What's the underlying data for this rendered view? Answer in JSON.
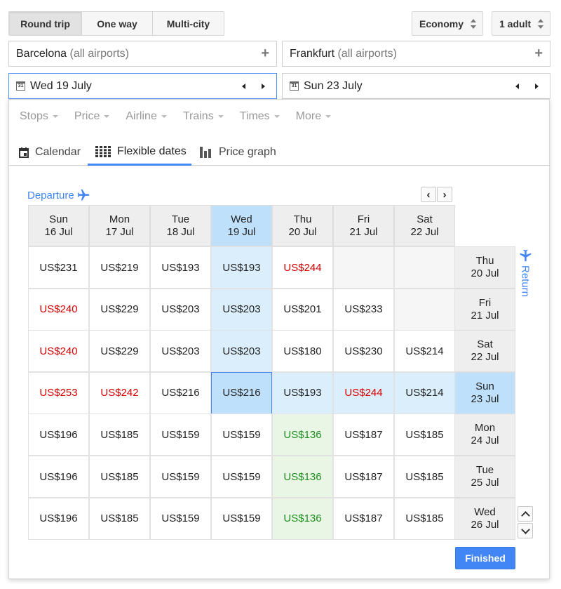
{
  "trip_types": [
    {
      "label": "Round trip",
      "active": true
    },
    {
      "label": "One way",
      "active": false
    },
    {
      "label": "Multi-city",
      "active": false
    }
  ],
  "cabin": "Economy",
  "passengers": "1 adult",
  "origin": {
    "city": "Barcelona",
    "sub": "(all airports)"
  },
  "destination": {
    "city": "Frankfurt",
    "sub": "(all airports)"
  },
  "departure_date": "Wed 19 July",
  "return_date": "Sun 23 July",
  "filters": [
    "Stops",
    "Price",
    "Airline",
    "Trains",
    "Times",
    "More"
  ],
  "tabs": [
    {
      "label": "Calendar",
      "icon": "calendar-icon",
      "active": false
    },
    {
      "label": "Flexible dates",
      "icon": "grid-icon",
      "active": true
    },
    {
      "label": "Price graph",
      "icon": "bar-chart-icon",
      "active": false
    }
  ],
  "departure_label": "Departure",
  "return_label": "Return",
  "departure_days": [
    {
      "day": "Sun",
      "date": "16 Jul"
    },
    {
      "day": "Mon",
      "date": "17 Jul"
    },
    {
      "day": "Tue",
      "date": "18 Jul"
    },
    {
      "day": "Wed",
      "date": "19 Jul"
    },
    {
      "day": "Thu",
      "date": "20 Jul"
    },
    {
      "day": "Fri",
      "date": "21 Jul"
    },
    {
      "day": "Sat",
      "date": "22 Jul"
    }
  ],
  "return_days": [
    {
      "day": "Thu",
      "date": "20 Jul"
    },
    {
      "day": "Fri",
      "date": "21 Jul"
    },
    {
      "day": "Sat",
      "date": "22 Jul"
    },
    {
      "day": "Sun",
      "date": "23 Jul"
    },
    {
      "day": "Mon",
      "date": "24 Jul"
    },
    {
      "day": "Tue",
      "date": "25 Jul"
    },
    {
      "day": "Wed",
      "date": "26 Jul"
    }
  ],
  "selected_departure_index": 3,
  "selected_return_index": 3,
  "prices": [
    [
      "US$231",
      "US$219",
      "US$193",
      "US$193",
      "US$244",
      "",
      ""
    ],
    [
      "US$240",
      "US$229",
      "US$203",
      "US$203",
      "US$201",
      "US$233",
      ""
    ],
    [
      "US$240",
      "US$229",
      "US$203",
      "US$203",
      "US$180",
      "US$230",
      "US$214"
    ],
    [
      "US$253",
      "US$242",
      "US$216",
      "US$216",
      "US$193",
      "US$244",
      "US$214"
    ],
    [
      "US$196",
      "US$185",
      "US$159",
      "US$159",
      "US$136",
      "US$187",
      "US$185"
    ],
    [
      "US$196",
      "US$185",
      "US$159",
      "US$159",
      "US$136",
      "US$187",
      "US$185"
    ],
    [
      "US$196",
      "US$185",
      "US$159",
      "US$159",
      "US$136",
      "US$187",
      "US$185"
    ]
  ],
  "price_colors": [
    [
      "normal",
      "normal",
      "normal",
      "normal",
      "high",
      "",
      ""
    ],
    [
      "high",
      "normal",
      "normal",
      "normal",
      "normal",
      "normal",
      ""
    ],
    [
      "high",
      "normal",
      "normal",
      "normal",
      "normal",
      "normal",
      "normal"
    ],
    [
      "high",
      "high",
      "normal",
      "normal",
      "normal",
      "high",
      "normal"
    ],
    [
      "normal",
      "normal",
      "normal",
      "normal",
      "low",
      "normal",
      "normal"
    ],
    [
      "normal",
      "normal",
      "normal",
      "normal",
      "low",
      "normal",
      "normal"
    ],
    [
      "normal",
      "normal",
      "normal",
      "normal",
      "low",
      "normal",
      "normal"
    ]
  ],
  "colors": {
    "accent": "#4285f4",
    "high": "#d50000",
    "low": "#1e8e1e",
    "selected": "#bfe0fa"
  },
  "finished_label": "Finished"
}
